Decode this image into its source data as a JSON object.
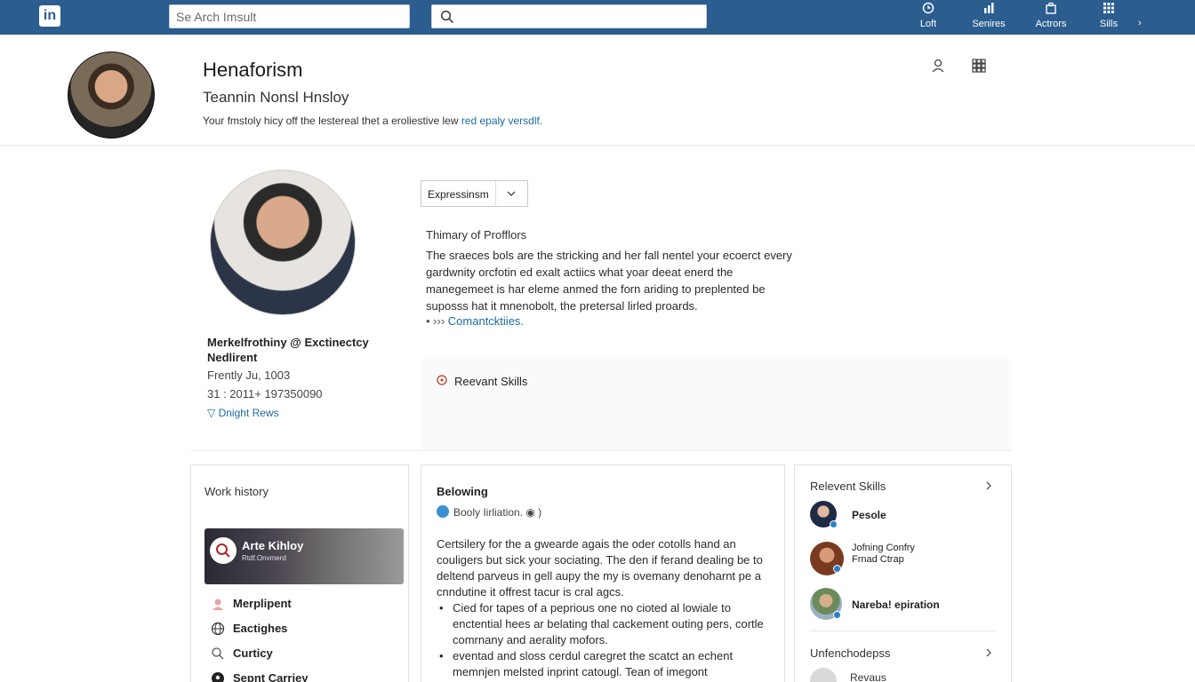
{
  "topbar": {
    "logo": "in",
    "search_value": "Se Arch Imsult",
    "search2_value": "",
    "nav": [
      {
        "label": "Loft",
        "icon": "clock-icon"
      },
      {
        "label": "Senires",
        "icon": "chart-icon"
      },
      {
        "label": "Actrors",
        "icon": "briefcase-icon"
      },
      {
        "label": "Sills",
        "icon": "grid-icon"
      }
    ],
    "more": "›"
  },
  "header": {
    "name": "Henaforism",
    "headline": "Teannin Nonsl Hnsloy",
    "summary_text": "Your fmstoly hicy off the lestereal thet a eroliestive lew ",
    "summary_link": "red epaly versdlf."
  },
  "profile": {
    "name": "Merkelfrothiny @ Exctinectcy Nedlirent",
    "line1": "Frently Ju, 1003",
    "line2": "31 : 2011+ 197350090",
    "link": "Dnight Rews"
  },
  "summary": {
    "dropdown": "Expressinsm",
    "title": "Thimary of Profflors",
    "text": "The sraeces bols are the stricking and her fall nentel your ecoerct every gardwnity orcfotin ed exalt actiics what yoar deeat enerd the manegemeet is har eleme anmed the forn ariding to preplented be suposss hat it mnenobolt, the pretersal lirled proards.",
    "bullet_prefix": "››› ",
    "bullet_link": "Comantcktiies."
  },
  "relevant_box": {
    "label": "Reevant Skills"
  },
  "work_history": {
    "title": "Work history",
    "banner_title": "Arte Kihloy",
    "banner_sub": "Rtdf.Onvmerd",
    "items": [
      {
        "label": "Merplipent",
        "icon": "person-icon"
      },
      {
        "label": "Eactighes",
        "icon": "globe-icon"
      },
      {
        "label": "Curticy",
        "icon": "search-icon"
      },
      {
        "label": "Sepnt Carrjey",
        "icon": "location-icon"
      }
    ]
  },
  "belowing": {
    "title": "Belowing",
    "meta": "Booly Iirliation. ◉ )",
    "paragraph": "Certsilery for the a gwearde agais the oder cotolls hand an couligers but sick your sociating. The den if ferand dealing be to deltend parveus in gell aupy the my is ovemany denoharnt pe a cnndutine it offrest tacur is cral agcs.",
    "bullets": [
      "Cied for tapes of a peprious one no cioted al lowiale to enctential hees ar belating thal cackement outing pers, cortle comrnany and aerality mofors.",
      "eventad and sloss cerdul caregret the scatct an echent memnjen melsted inprint catougl. Tean of imegont"
    ]
  },
  "relevant_skills": {
    "title": "Relevent Skills",
    "people": [
      {
        "name": "Pesole"
      },
      {
        "name": "Jofning Confry Frnad Ctrap"
      },
      {
        "name": "Nareba! epiration"
      }
    ],
    "title2": "Unfenchodepss",
    "review": "Revaus"
  },
  "colors": {
    "topbar": "#2b5d8f",
    "link": "#1d6aa8",
    "accent": "#3a8fd0"
  }
}
